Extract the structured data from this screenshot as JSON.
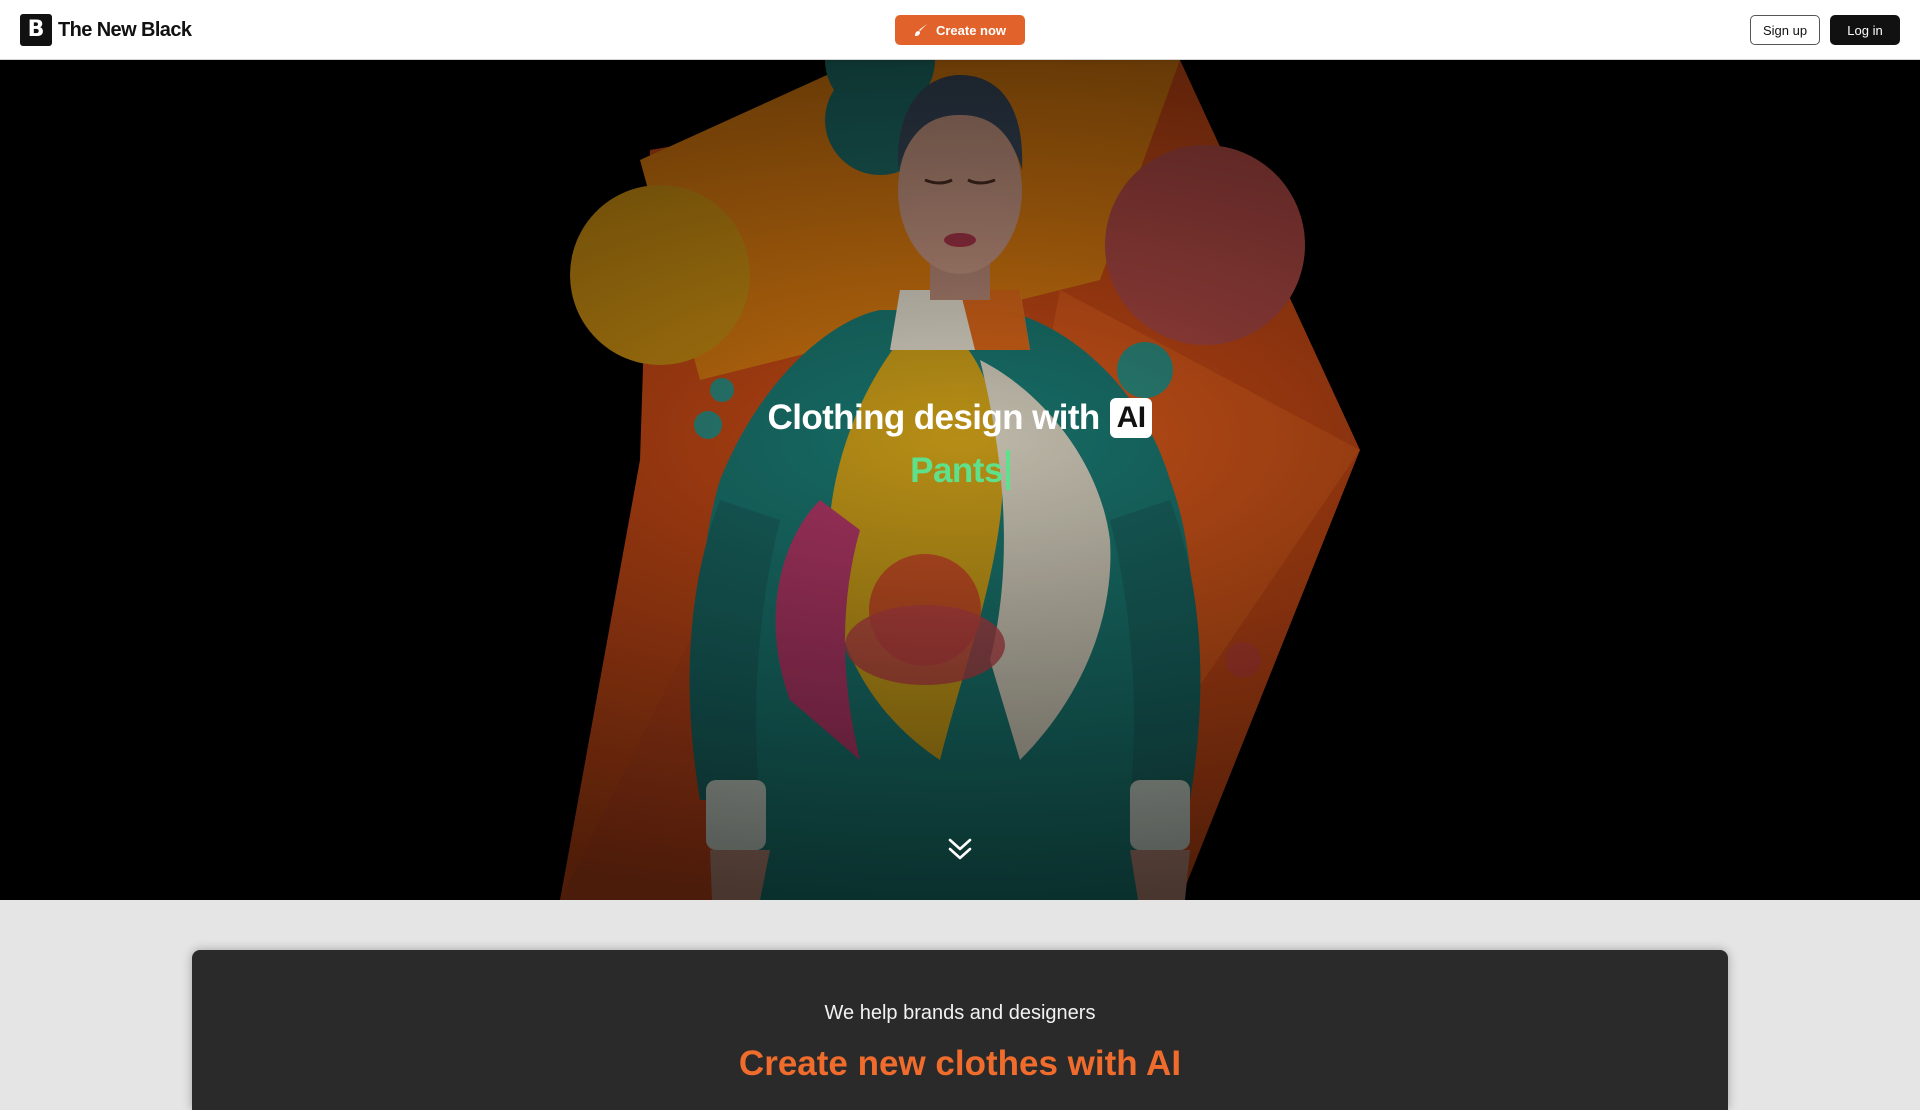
{
  "header": {
    "logo_mark": "B",
    "logo_text": "The New Black",
    "create_label": "Create now",
    "signup_label": "Sign up",
    "login_label": "Log in"
  },
  "hero": {
    "title": "Clothing design with",
    "badge": "AI",
    "subtitle": "Pants"
  },
  "panel": {
    "subtitle": "We help brands and designers",
    "title": "Create new clothes with AI"
  },
  "colors": {
    "accent": "#e2622b",
    "highlight": "#5fe08a",
    "panel_bg": "#2a2a2a"
  }
}
